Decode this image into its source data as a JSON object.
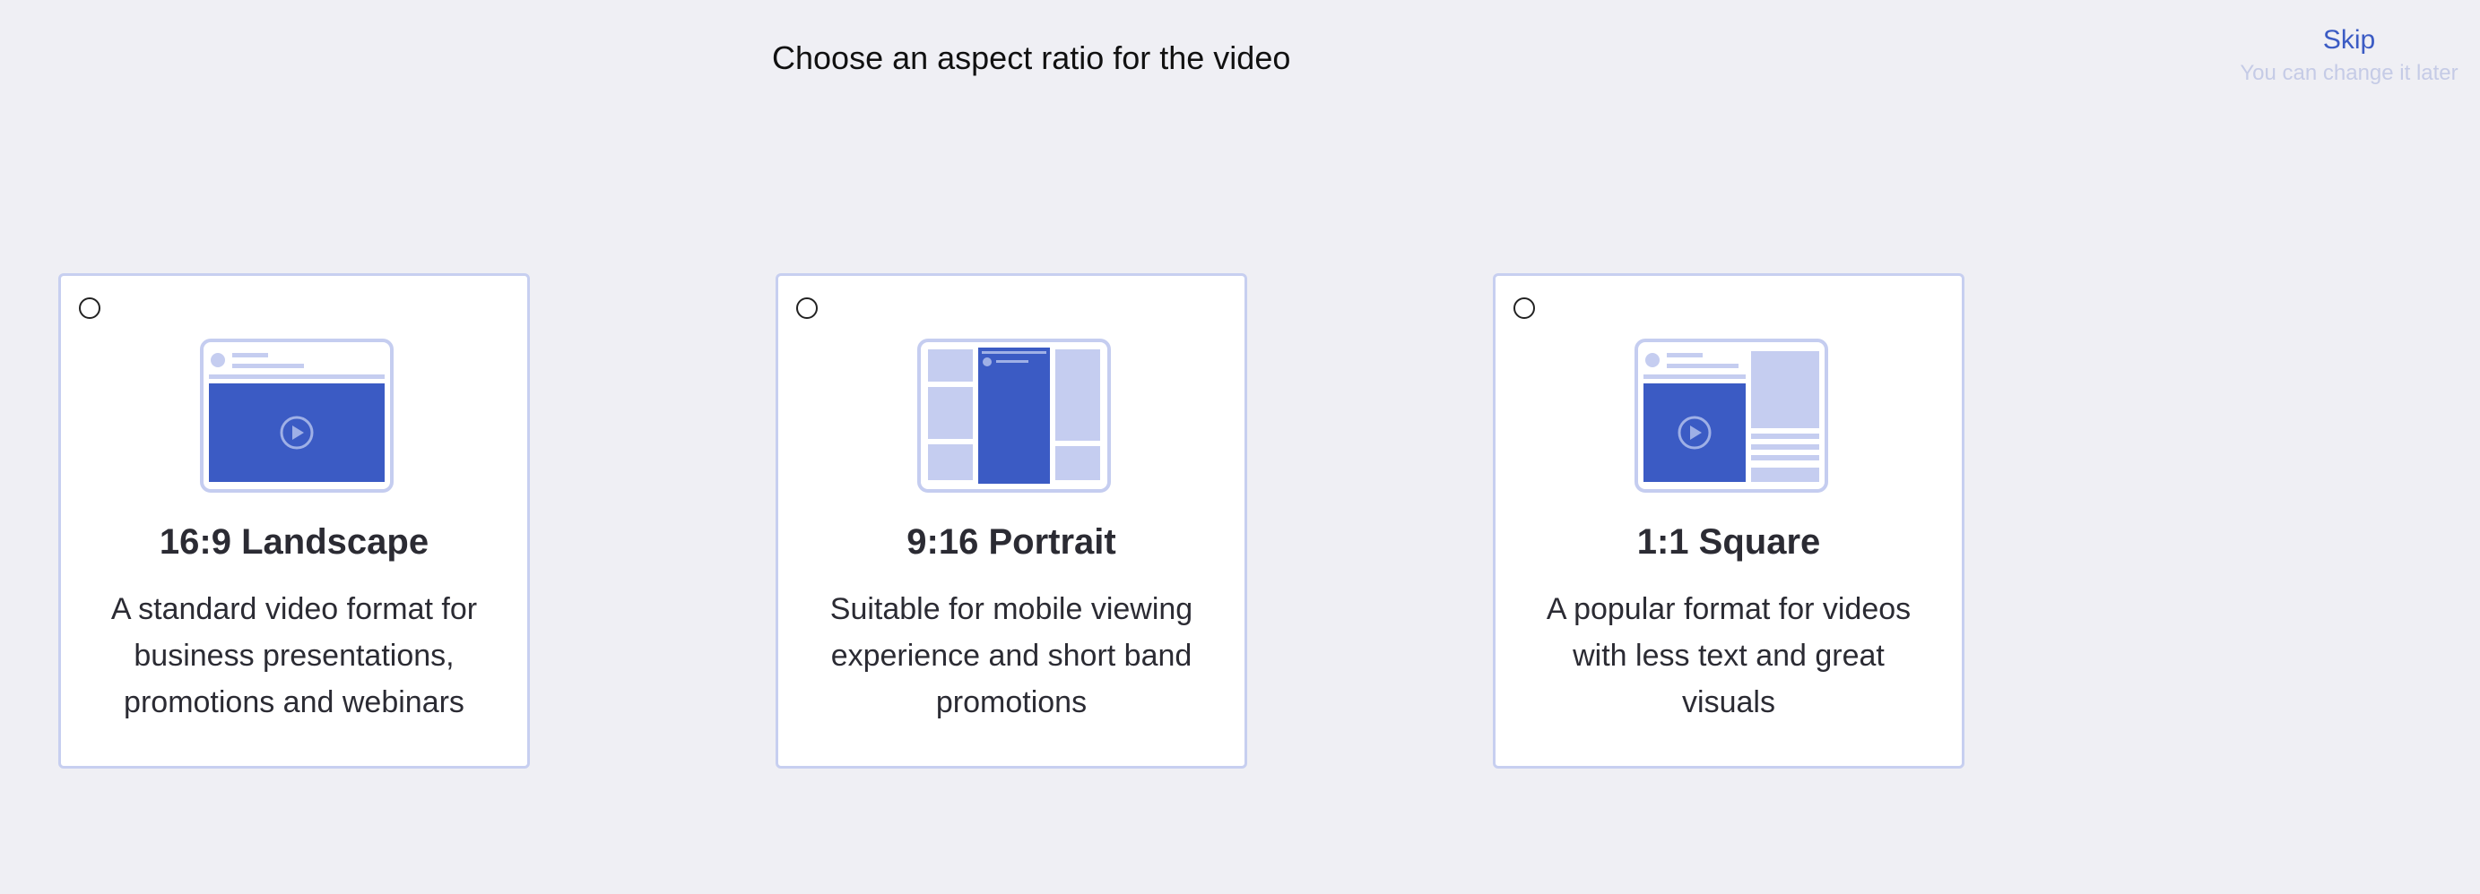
{
  "header": {
    "title": "Choose an aspect ratio for the video",
    "skip_label": "Skip",
    "skip_hint": "You can change it later"
  },
  "options": [
    {
      "title": "16:9 Landscape",
      "description": "A standard video format for business presentations, promotions and webinars",
      "selected": false,
      "icon": "landscape-layout-icon"
    },
    {
      "title": "9:16 Portrait",
      "description": "Suitable for mobile viewing experience and short band promotions",
      "selected": false,
      "icon": "portrait-layout-icon"
    },
    {
      "title": "1:1 Square",
      "description": "A popular format for videos with less text and great visuals",
      "selected": false,
      "icon": "square-layout-icon"
    }
  ],
  "colors": {
    "background": "#efeff4",
    "accent": "#3b5bc4",
    "card_border": "#c7cff0",
    "thumb_light": "#c5cdf0"
  }
}
